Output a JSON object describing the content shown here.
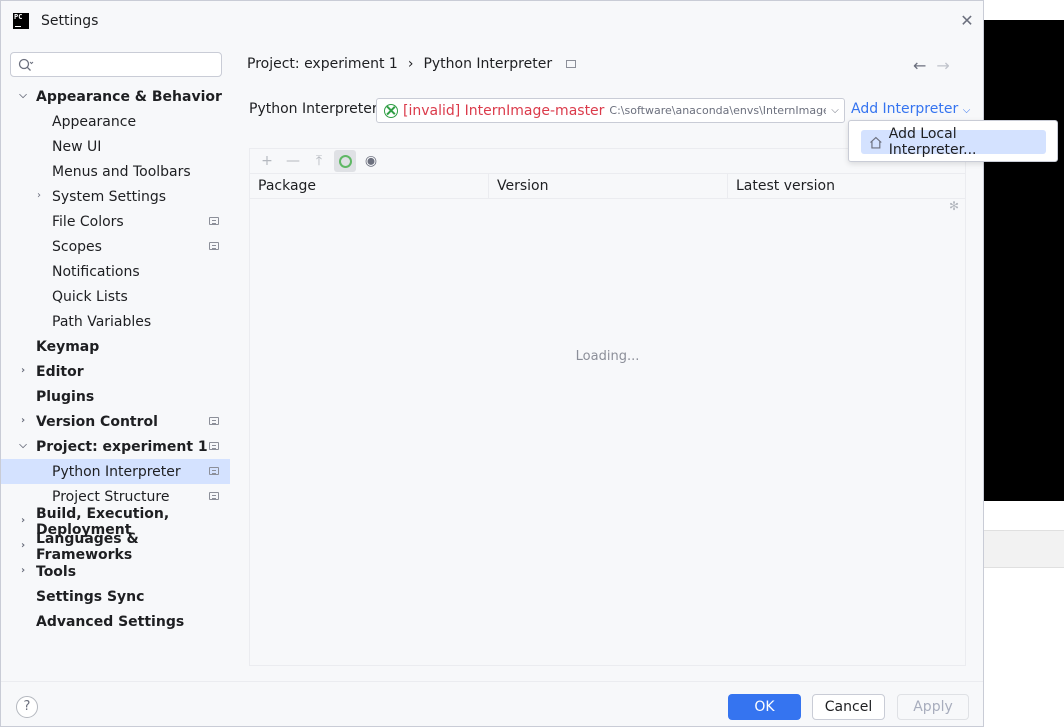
{
  "window": {
    "title": "Settings",
    "app_icon_text": "PC"
  },
  "sidebar": {
    "search_placeholder": "",
    "items": [
      {
        "label": "Appearance & Behavior",
        "level": 0,
        "bold": true,
        "expanded": true
      },
      {
        "label": "Appearance",
        "level": 1
      },
      {
        "label": "New UI",
        "level": 1
      },
      {
        "label": "Menus and Toolbars",
        "level": 1
      },
      {
        "label": "System Settings",
        "level": 1,
        "collapsed": true
      },
      {
        "label": "File Colors",
        "level": 1,
        "badge": true
      },
      {
        "label": "Scopes",
        "level": 1,
        "badge": true
      },
      {
        "label": "Notifications",
        "level": 1
      },
      {
        "label": "Quick Lists",
        "level": 1
      },
      {
        "label": "Path Variables",
        "level": 1
      },
      {
        "label": "Keymap",
        "level": 0,
        "bold": true
      },
      {
        "label": "Editor",
        "level": 0,
        "bold": true,
        "collapsed": true
      },
      {
        "label": "Plugins",
        "level": 0,
        "bold": true
      },
      {
        "label": "Version Control",
        "level": 0,
        "bold": true,
        "collapsed": true,
        "badge": true
      },
      {
        "label": "Project: experiment 1",
        "level": 0,
        "bold": true,
        "expanded": true,
        "badge": true
      },
      {
        "label": "Python Interpreter",
        "level": 1,
        "badge": true,
        "selected": true
      },
      {
        "label": "Project Structure",
        "level": 1,
        "badge": true
      },
      {
        "label": "Build, Execution, Deployment",
        "level": 0,
        "bold": true,
        "collapsed": true
      },
      {
        "label": "Languages & Frameworks",
        "level": 0,
        "bold": true,
        "collapsed": true
      },
      {
        "label": "Tools",
        "level": 0,
        "bold": true,
        "collapsed": true
      },
      {
        "label": "Settings Sync",
        "level": 0,
        "bold": true
      },
      {
        "label": "Advanced Settings",
        "level": 0,
        "bold": true
      }
    ]
  },
  "breadcrumb": {
    "parent": "Project: experiment 1",
    "separator": "›",
    "current": "Python Interpreter"
  },
  "nav": {
    "back": "←",
    "forward": "→"
  },
  "interpreter": {
    "label": "Python Interpreter:",
    "name": "[invalid] InternImage-master",
    "path": "C:\\software\\anaconda\\envs\\InternImage-master",
    "add_label": "Add Interpreter"
  },
  "toolbar": {
    "add": "+",
    "remove": "—",
    "upgrade": "⤒",
    "eye": "◉"
  },
  "table": {
    "columns": [
      "Package",
      "Version",
      "Latest version"
    ],
    "loading_text": "Loading..."
  },
  "popup": {
    "item_label": "Add Local Interpreter..."
  },
  "footer": {
    "help": "?",
    "ok": "OK",
    "cancel": "Cancel",
    "apply": "Apply"
  },
  "colors": {
    "accent": "#3574f0",
    "selection": "#d4e2ff",
    "invalid": "#db3b4b"
  }
}
